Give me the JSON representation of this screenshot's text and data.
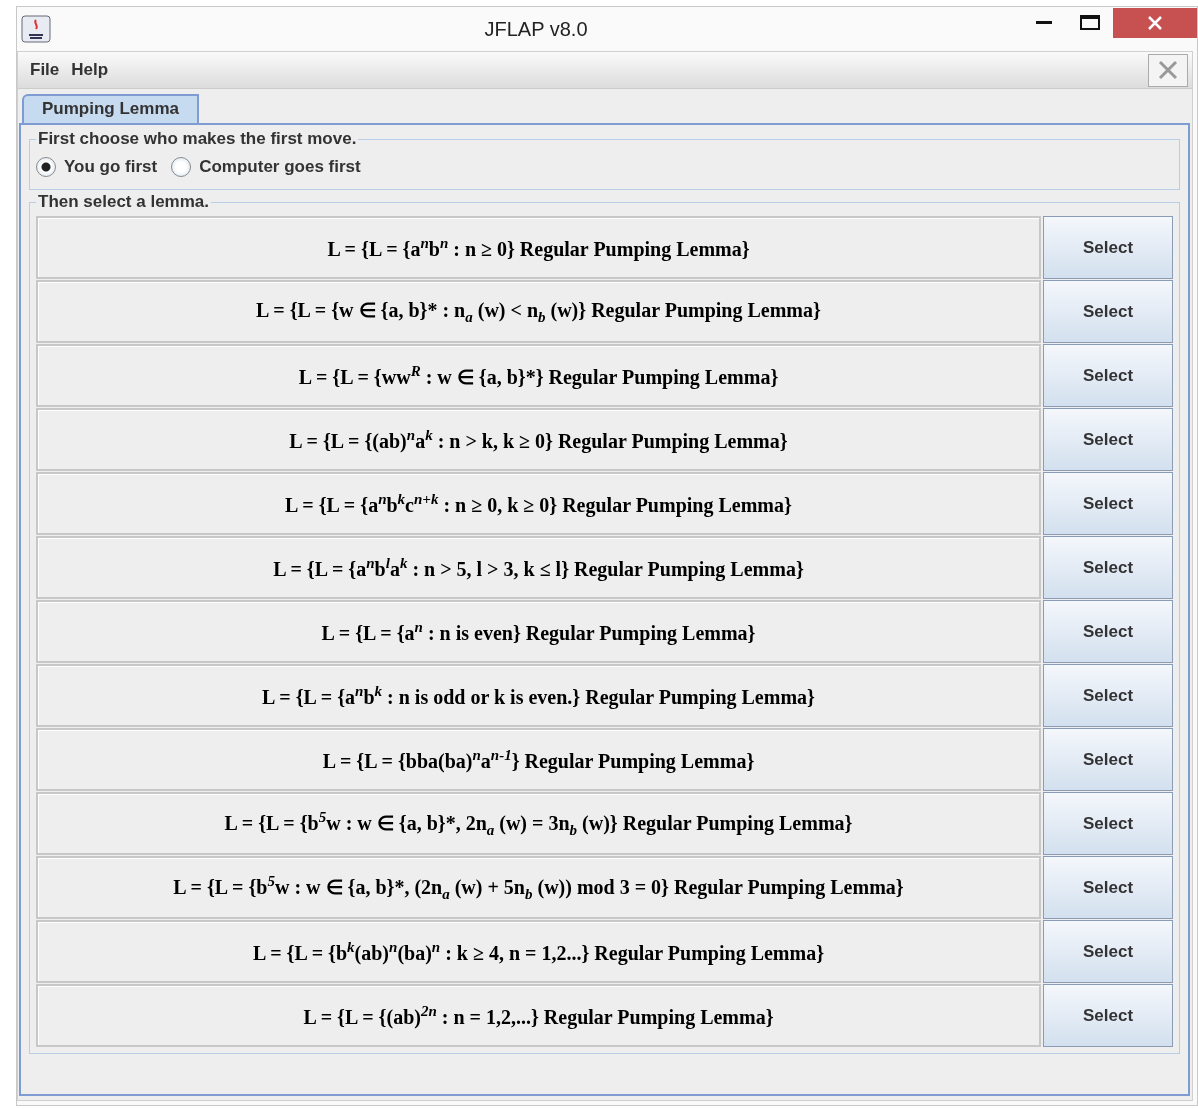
{
  "window": {
    "title": "JFLAP v8.0"
  },
  "menu": [
    "File",
    "Help"
  ],
  "tabs": [
    {
      "label": "Pumping Lemma",
      "selected": true
    }
  ],
  "first_move": {
    "legend": "First choose who makes the first move.",
    "options": [
      {
        "label": "You go first",
        "selected": true
      },
      {
        "label": "Computer goes first",
        "selected": false
      }
    ]
  },
  "lemmas": {
    "legend": "Then select a lemma.",
    "items": [
      {
        "text": "L = {L = {a$^{n}$b$^{n}$ : n ≥ 0} Regular Pumping Lemma}",
        "button": "Select"
      },
      {
        "text": "L = {L = {w ∈ {a, b}* : n$_{a}$ (w) < n$_{b}$ (w)} Regular Pumping Lemma}",
        "button": "Select"
      },
      {
        "text": "L = {L = {ww$^{R}$ : w ∈ {a, b}*} Regular Pumping Lemma}",
        "button": "Select"
      },
      {
        "text": "L = {L = {(ab)$^{n}$a$^{k}$ : n > k, k ≥ 0} Regular Pumping Lemma}",
        "button": "Select"
      },
      {
        "text": "L = {L = {a$^{n}$b$^{k}$c$^{n+k}$ : n ≥ 0, k ≥ 0} Regular Pumping Lemma}",
        "button": "Select"
      },
      {
        "text": "L = {L = {a$^{n}$b$^{l}$a$^{k}$ : n > 5, l > 3, k ≤ l} Regular Pumping Lemma}",
        "button": "Select"
      },
      {
        "text": "L = {L = {a$^{n}$ : n is even} Regular Pumping Lemma}",
        "button": "Select"
      },
      {
        "text": "L = {L = {a$^{n}$b$^{k}$ : n is odd or k is even.} Regular Pumping Lemma}",
        "button": "Select"
      },
      {
        "text": "L = {L = {bba(ba)$^{n}$a$^{n-1}$} Regular Pumping Lemma}",
        "button": "Select"
      },
      {
        "text": "L = {L = {b$^{5}$w : w ∈ {a, b}*, 2n$_{a}$ (w) = 3n$_{b}$ (w)} Regular Pumping Lemma}",
        "button": "Select"
      },
      {
        "text": "L = {L = {b$^{5}$w : w ∈ {a, b}*, (2n$_{a}$ (w) + 5n$_{b}$ (w)) mod 3 = 0} Regular Pumping Lemma}",
        "button": "Select"
      },
      {
        "text": "L = {L = {b$^{k}$(ab)$^{n}$(ba)$^{n}$ : k ≥ 4, n = 1,2...} Regular Pumping Lemma}",
        "button": "Select"
      },
      {
        "text": "L = {L = {(ab)$^{2n}$ : n = 1,2,...} Regular Pumping Lemma}",
        "button": "Select"
      }
    ]
  }
}
